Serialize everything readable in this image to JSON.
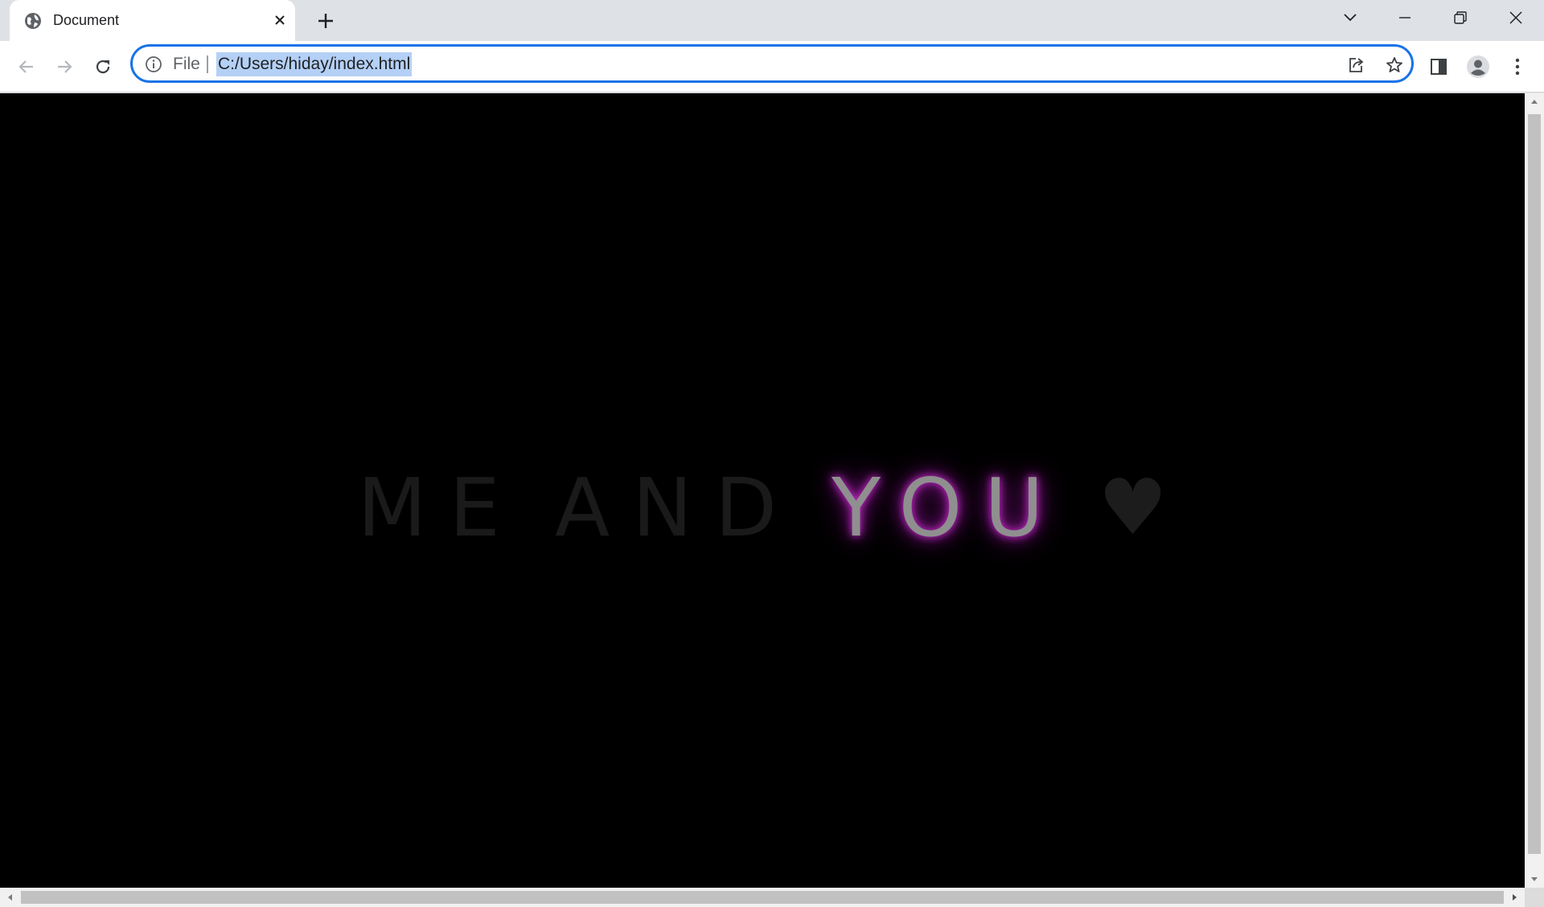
{
  "tab": {
    "title": "Document",
    "favicon": "globe-icon"
  },
  "window_controls": [
    "tab-search-icon",
    "minimize-icon",
    "restore-icon",
    "close-icon"
  ],
  "address_bar": {
    "scheme_label": "File",
    "url": "C:/Users/hiday/index.html"
  },
  "page": {
    "word_me": "ME",
    "word_and": "AND",
    "word_you": "YOU",
    "heart": "♥",
    "background_color": "#000000",
    "glow_color": "#d02fd6"
  }
}
